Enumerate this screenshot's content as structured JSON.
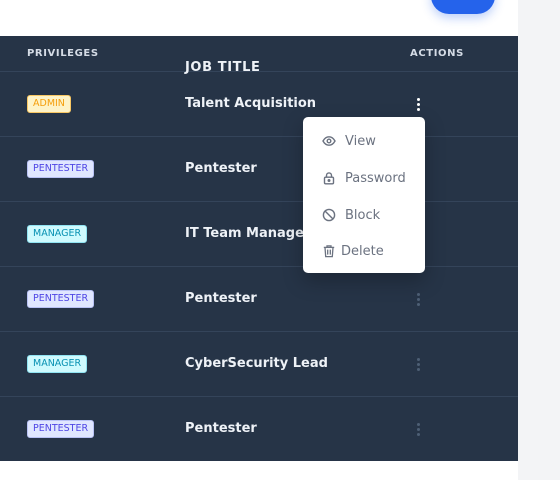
{
  "table": {
    "headers": {
      "privileges": "PRIVILEGES",
      "job_title": "JOB TITLE",
      "actions": "ACTIONS"
    },
    "rows": [
      {
        "privilege": "ADMIN",
        "privilege_kind": "admin",
        "job_title": "Talent Acquisition"
      },
      {
        "privilege": "PENTESTER",
        "privilege_kind": "pentester",
        "job_title": "Pentester"
      },
      {
        "privilege": "MANAGER",
        "privilege_kind": "manager",
        "job_title": "IT Team Manager"
      },
      {
        "privilege": "PENTESTER",
        "privilege_kind": "pentester",
        "job_title": "Pentester"
      },
      {
        "privilege": "MANAGER",
        "privilege_kind": "manager",
        "job_title": "CyberSecurity Lead"
      },
      {
        "privilege": "PENTESTER",
        "privilege_kind": "pentester",
        "job_title": "Pentester"
      }
    ]
  },
  "actions_menu": {
    "open_for_row": 0,
    "items": [
      {
        "label": "View",
        "icon": "eye-icon"
      },
      {
        "label": "Password",
        "icon": "lock-icon"
      },
      {
        "label": "Block",
        "icon": "block-icon"
      },
      {
        "label": "Delete",
        "icon": "trash-icon"
      }
    ]
  },
  "colors": {
    "accent": "#2563eb",
    "table_bg": "#263447",
    "admin": "#f59e0b",
    "pentester": "#4f46e5",
    "manager": "#0891b2"
  }
}
